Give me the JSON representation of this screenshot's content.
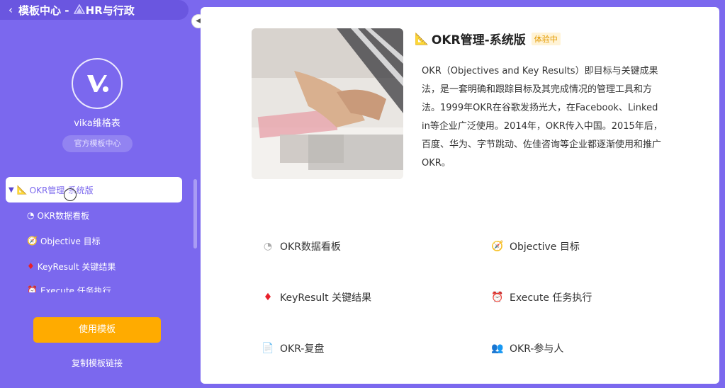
{
  "header": {
    "back_icon": "chevron-left-icon",
    "title_prefix": "模板中心 - ",
    "title_icon": "🔼",
    "title_rest": "HR与行政"
  },
  "org": {
    "name": "vika维格表",
    "badge": "官方模板中心"
  },
  "tree": {
    "root": {
      "caret": "▼",
      "icon": "📐",
      "label": "OKR管理-系统版"
    },
    "items": [
      {
        "icon": "◔",
        "label": "OKR数据看板"
      },
      {
        "icon": "🧭",
        "label": "Objective 目标"
      },
      {
        "icon": "♦",
        "label": "KeyResult 关键结果"
      },
      {
        "icon": "⏰",
        "label": "Execute 任务执行"
      }
    ]
  },
  "actions": {
    "use_template": "使用模板",
    "copy_link": "复制模板链接"
  },
  "template": {
    "title_icon": "📐",
    "title": "OKR管理-系统版",
    "badge": "体验中",
    "description": "OKR（Objectives and Key Results）即目标与关键成果法，是一套明确和跟踪目标及其完成情况的管理工具和方法。1999年OKR在谷歌发扬光大，在Facebook、Linked in等企业广泛使用。2014年，OKR传入中国。2015年后，百度、华为、字节跳动、佐佳咨询等企业都逐渐使用和推广OKR。"
  },
  "views": [
    {
      "icon": "◔",
      "label": "OKR数据看板"
    },
    {
      "icon": "🧭",
      "label": "Objective 目标"
    },
    {
      "icon": "♦",
      "label": "KeyResult 关键结果"
    },
    {
      "icon": "⏰",
      "label": "Execute 任务执行"
    },
    {
      "icon": "📄",
      "label": "OKR-复盘"
    },
    {
      "icon": "👥",
      "label": "OKR-参与人"
    }
  ],
  "colors": {
    "brand": "#7b68ee",
    "accent": "#ffab00",
    "trial_badge": "#e39a00"
  }
}
